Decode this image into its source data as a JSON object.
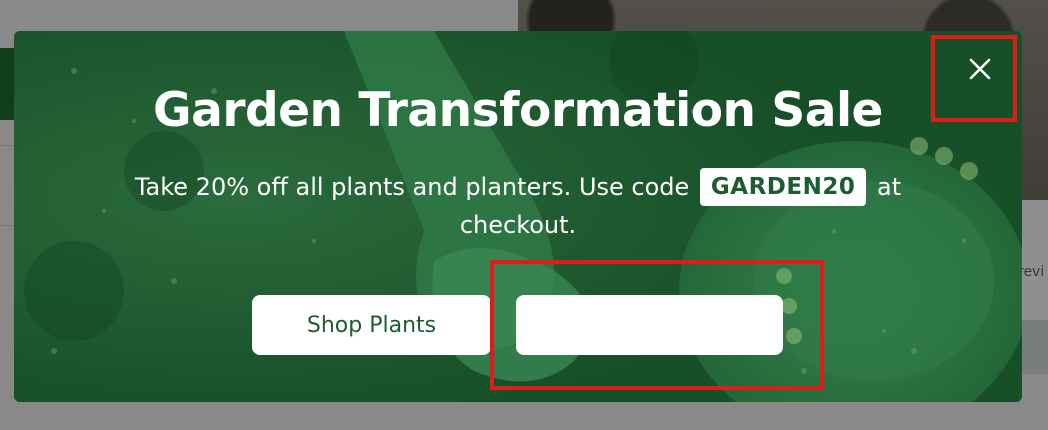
{
  "background_page": {
    "partial_text": "revi"
  },
  "modal": {
    "title": "Garden Transformation Sale",
    "message_before_code": "Take 20% off all plants and planters. Use code",
    "promo_code": "GARDEN20",
    "message_after_code": "at",
    "message_line2": "checkout.",
    "close_icon": "close-icon",
    "buttons": {
      "shop_label": "Shop Plants",
      "secondary_label": ""
    }
  },
  "colors": {
    "modal_green": "#1a5a2e",
    "accent_text_green": "#1c5c30",
    "button_white": "#ffffff",
    "highlight_red": "#e01b1b"
  }
}
